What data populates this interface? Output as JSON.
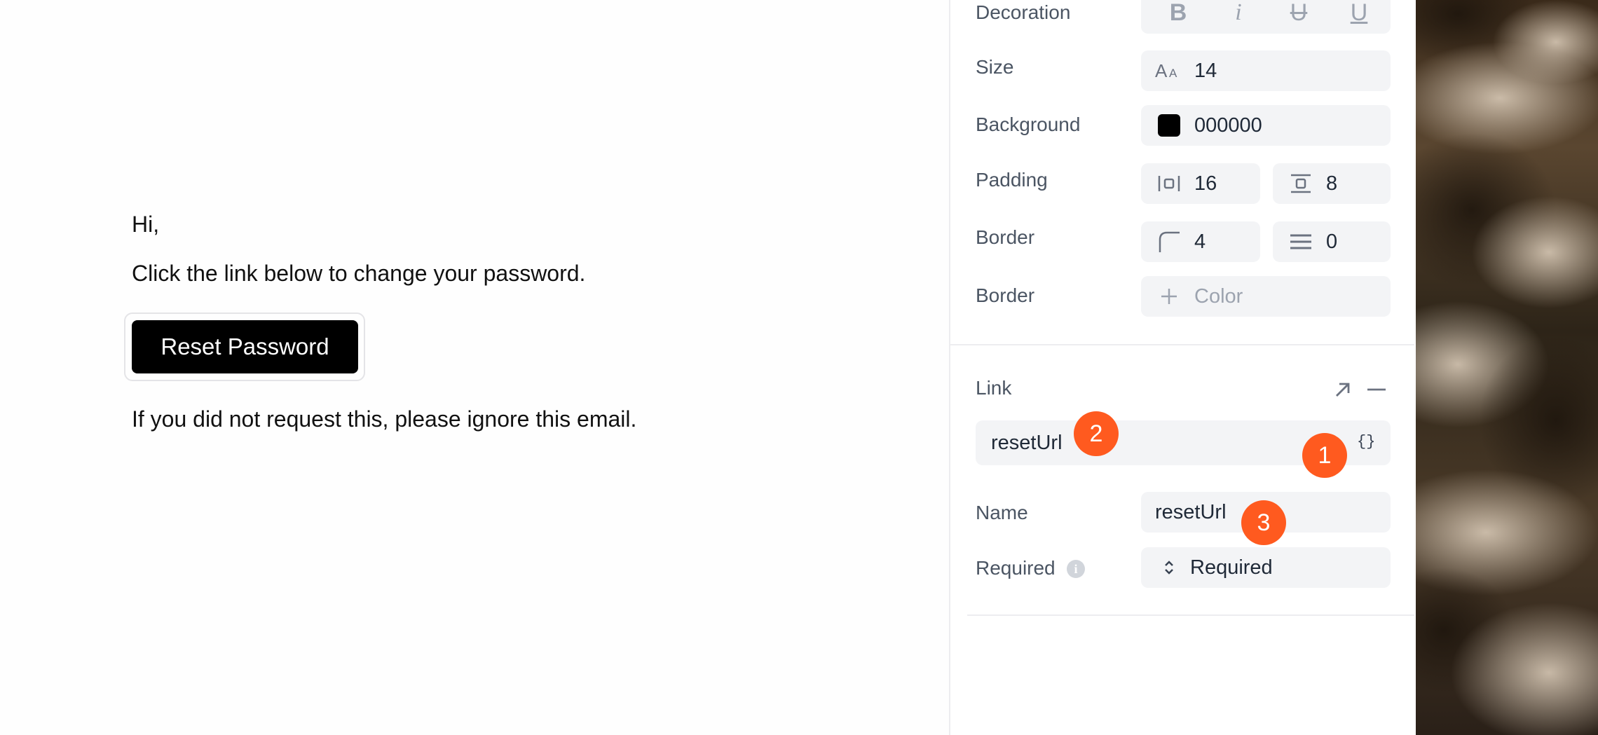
{
  "email": {
    "greeting": "Hi,",
    "line1": "Click the link below to change your password.",
    "button_label": "Reset Password",
    "line2": "If you did not request this, please ignore this email."
  },
  "panel": {
    "decoration": {
      "label": "Decoration",
      "bold": "B",
      "italic": "i",
      "strike": "U",
      "underline": "U"
    },
    "size": {
      "label": "Size",
      "value": "14"
    },
    "background": {
      "label": "Background",
      "value": "000000",
      "swatch": "#000000"
    },
    "padding": {
      "label": "Padding",
      "horizontal": "16",
      "vertical": "8"
    },
    "border_radius": {
      "label": "Border",
      "radius": "4",
      "width": "0"
    },
    "border_color": {
      "label": "Border",
      "placeholder": "Color"
    },
    "link": {
      "title": "Link",
      "value": "resetUrl",
      "variable_toggle": "{}",
      "name_label": "Name",
      "name_value": "resetUrl",
      "required_label": "Required",
      "required_value": "Required"
    }
  },
  "badges": {
    "one": "1",
    "two": "2",
    "three": "3"
  },
  "colors": {
    "accent": "#ff5a1f",
    "button": "#000000"
  }
}
